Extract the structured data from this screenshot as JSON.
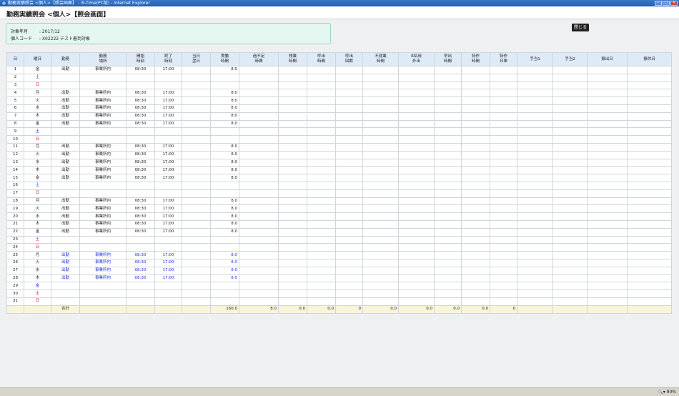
{
  "window": {
    "title": "勤務実績照会 <個人>【照会画面】 - iS-Time(PC版) - Internet Explorer"
  },
  "page_title": "勤務実績照会 <個人>【照会画面】",
  "info": {
    "period_label": "対象年月",
    "period_value": ": 2017/12",
    "code_label": "個人コード",
    "code_value": ": X02222 テスト着到対象"
  },
  "close_button": "閉じる",
  "columns": [
    "日",
    "曜日",
    "勤務",
    "勤務\n場所",
    "開始\n時刻",
    "終了\n時刻",
    "当日\n翌日",
    "実働\n時間",
    "過不足\n時間",
    "残業\n時間",
    "呼出\n時間",
    "呼出\n回数",
    "不就業\n時間",
    "R私用\n外出",
    "早出\n時間",
    "特作\n時間",
    "特作\n日単",
    "手当1",
    "手当2",
    "振出日",
    "振休日"
  ],
  "rows": [
    {
      "day": "1",
      "dow": "金",
      "cls": "",
      "work": "出勤",
      "place": "事業所内",
      "start": "08:30",
      "end": "17:00",
      "actual": "8.0",
      "blue": false
    },
    {
      "day": "2",
      "dow": "土",
      "cls": "sat",
      "work": "",
      "place": "",
      "start": "",
      "end": "",
      "actual": "",
      "blue": false
    },
    {
      "day": "3",
      "dow": "日",
      "cls": "sun",
      "work": "",
      "place": "",
      "start": "",
      "end": "",
      "actual": "",
      "blue": false
    },
    {
      "day": "4",
      "dow": "月",
      "cls": "",
      "work": "出勤",
      "place": "事業所内",
      "start": "08:30",
      "end": "17:00",
      "actual": "8.0",
      "blue": false
    },
    {
      "day": "5",
      "dow": "火",
      "cls": "",
      "work": "出勤",
      "place": "事業所内",
      "start": "08:30",
      "end": "17:00",
      "actual": "8.0",
      "blue": false
    },
    {
      "day": "6",
      "dow": "水",
      "cls": "",
      "work": "出勤",
      "place": "事業所内",
      "start": "08:30",
      "end": "17:00",
      "actual": "8.0",
      "blue": false
    },
    {
      "day": "7",
      "dow": "木",
      "cls": "",
      "work": "出勤",
      "place": "事業所内",
      "start": "08:30",
      "end": "17:00",
      "actual": "8.0",
      "blue": false
    },
    {
      "day": "8",
      "dow": "金",
      "cls": "",
      "work": "出勤",
      "place": "事業所内",
      "start": "08:30",
      "end": "17:00",
      "actual": "8.0",
      "blue": false
    },
    {
      "day": "9",
      "dow": "土",
      "cls": "sat",
      "work": "",
      "place": "",
      "start": "",
      "end": "",
      "actual": "",
      "blue": false
    },
    {
      "day": "10",
      "dow": "日",
      "cls": "sun",
      "work": "",
      "place": "",
      "start": "",
      "end": "",
      "actual": "",
      "blue": false
    },
    {
      "day": "11",
      "dow": "月",
      "cls": "",
      "work": "出勤",
      "place": "事業所内",
      "start": "08:30",
      "end": "17:00",
      "actual": "8.0",
      "blue": false
    },
    {
      "day": "12",
      "dow": "火",
      "cls": "",
      "work": "出勤",
      "place": "事業所内",
      "start": "08:30",
      "end": "17:00",
      "actual": "8.0",
      "blue": false
    },
    {
      "day": "13",
      "dow": "水",
      "cls": "",
      "work": "出勤",
      "place": "事業所内",
      "start": "08:30",
      "end": "17:00",
      "actual": "8.0",
      "blue": false
    },
    {
      "day": "14",
      "dow": "木",
      "cls": "",
      "work": "出勤",
      "place": "事業所内",
      "start": "08:30",
      "end": "17:00",
      "actual": "8.0",
      "blue": false
    },
    {
      "day": "15",
      "dow": "金",
      "cls": "",
      "work": "出勤",
      "place": "事業所内",
      "start": "08:30",
      "end": "17:00",
      "actual": "8.0",
      "blue": false
    },
    {
      "day": "16",
      "dow": "土",
      "cls": "sat",
      "work": "",
      "place": "",
      "start": "",
      "end": "",
      "actual": "",
      "blue": false
    },
    {
      "day": "17",
      "dow": "日",
      "cls": "sun",
      "work": "",
      "place": "",
      "start": "",
      "end": "",
      "actual": "",
      "blue": false
    },
    {
      "day": "18",
      "dow": "月",
      "cls": "",
      "work": "出勤",
      "place": "事業所内",
      "start": "08:30",
      "end": "17:00",
      "actual": "8.0",
      "blue": false
    },
    {
      "day": "19",
      "dow": "火",
      "cls": "",
      "work": "出勤",
      "place": "事業所内",
      "start": "08:30",
      "end": "17:00",
      "actual": "8.0",
      "blue": false
    },
    {
      "day": "20",
      "dow": "水",
      "cls": "",
      "work": "出勤",
      "place": "事業所内",
      "start": "08:30",
      "end": "17:00",
      "actual": "8.0",
      "blue": false
    },
    {
      "day": "21",
      "dow": "木",
      "cls": "",
      "work": "出勤",
      "place": "事業所内",
      "start": "08:30",
      "end": "17:00",
      "actual": "8.0",
      "blue": false
    },
    {
      "day": "22",
      "dow": "金",
      "cls": "",
      "work": "出勤",
      "place": "事業所内",
      "start": "08:30",
      "end": "17:00",
      "actual": "8.0",
      "blue": false
    },
    {
      "day": "23",
      "dow": "土",
      "cls": "satp",
      "work": "",
      "place": "",
      "start": "",
      "end": "",
      "actual": "",
      "blue": false
    },
    {
      "day": "24",
      "dow": "日",
      "cls": "sun",
      "work": "",
      "place": "",
      "start": "",
      "end": "",
      "actual": "",
      "blue": false
    },
    {
      "day": "25",
      "dow": "月",
      "cls": "",
      "work": "出勤",
      "place": "事業所内",
      "start": "08:30",
      "end": "17:00",
      "actual": "8.0",
      "blue": true
    },
    {
      "day": "26",
      "dow": "火",
      "cls": "",
      "work": "出勤",
      "place": "事業所内",
      "start": "08:30",
      "end": "17:00",
      "actual": "8.0",
      "blue": true
    },
    {
      "day": "27",
      "dow": "水",
      "cls": "",
      "work": "出勤",
      "place": "事業所内",
      "start": "08:30",
      "end": "17:00",
      "actual": "8.0",
      "blue": true
    },
    {
      "day": "28",
      "dow": "木",
      "cls": "",
      "work": "出勤",
      "place": "事業所内",
      "start": "08:30",
      "end": "17:00",
      "actual": "8.0",
      "blue": true
    },
    {
      "day": "29",
      "dow": "金",
      "cls": "sat",
      "work": "",
      "place": "",
      "start": "",
      "end": "",
      "actual": "",
      "blue": false
    },
    {
      "day": "30",
      "dow": "土",
      "cls": "sun",
      "work": "",
      "place": "",
      "start": "",
      "end": "",
      "actual": "",
      "blue": false
    },
    {
      "day": "31",
      "dow": "日",
      "cls": "sun",
      "work": "",
      "place": "",
      "start": "",
      "end": "",
      "actual": "",
      "blue": false
    }
  ],
  "total": {
    "label": "合計",
    "values": [
      "",
      "",
      "",
      "",
      "160.0",
      "8.0",
      "0.0",
      "0.0",
      "0",
      "0.0",
      "0.0",
      "0.0",
      "0.0",
      "0",
      "",
      "",
      "",
      ""
    ]
  },
  "status": {
    "zoom": "90%"
  }
}
